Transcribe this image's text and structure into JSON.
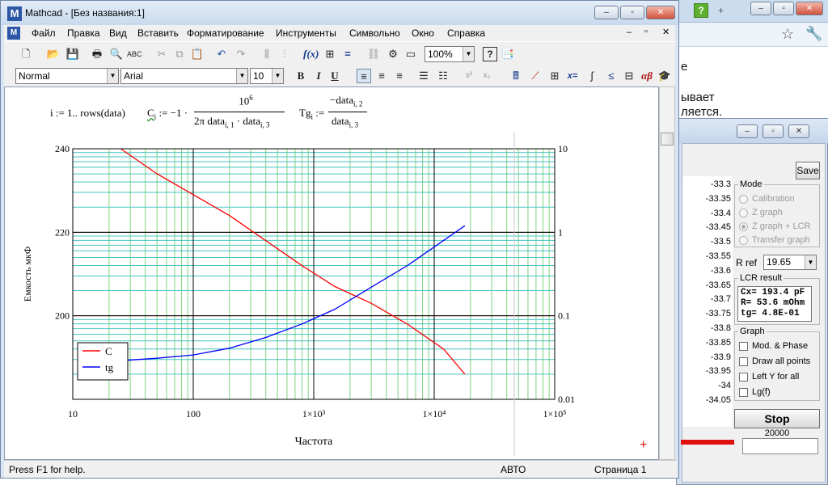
{
  "browser": {
    "fragment_line1": "е",
    "fragment_line2": "ывает",
    "fragment_line3": "ляется."
  },
  "lcr_app": {
    "save_label": "Save",
    "axis_ticks": [
      "-33.3",
      "-33.35",
      "-33.4",
      "-33.45",
      "-33.5",
      "-33.55",
      "-33.6",
      "-33.65",
      "-33.7",
      "-33.75",
      "-33.8",
      "-33.85",
      "-33.9",
      "-33.95",
      "-34",
      "-34.05"
    ],
    "mode_legend": "Mode",
    "mode_options": [
      {
        "label": "Calibration",
        "selected": false
      },
      {
        "label": "Z graph",
        "selected": false
      },
      {
        "label": "Z graph + LCR",
        "selected": true
      },
      {
        "label": "Transfer graph",
        "selected": false
      }
    ],
    "rref_label": "R ref",
    "rref_value": "19.65",
    "lcr_result_legend": "LCR result",
    "lcr_result_lines": [
      "Cx= 193.4 pF",
      "R= 53.6 mOhm",
      "tg= 4.8E-01"
    ],
    "graph_legend": "Graph",
    "graph_options": [
      {
        "label": "Mod. & Phase",
        "checked": false
      },
      {
        "label": "Draw all points",
        "checked": false
      },
      {
        "label": "Left Y for all",
        "checked": false
      },
      {
        "label": "Lg(f)",
        "checked": false
      }
    ],
    "stop_label": "Stop",
    "freq_value": "20000"
  },
  "mathcad": {
    "title": "Mathcad - [Без названия:1]",
    "menu": [
      "Файл",
      "Правка",
      "Вид",
      "Вставить",
      "Форматирование",
      "Инструменты",
      "Символьно",
      "Окно",
      "Справка"
    ],
    "zoom": "100%",
    "style_value": "Normal",
    "font_value": "Arial",
    "size_value": "10",
    "formulas": {
      "range_def": "i := 1.. rows(data)",
      "c_lhs": "C",
      "c_sub": "i",
      "c_rhs_prefix": ":= −1 ·",
      "c_num": "10",
      "c_num_exp": "6",
      "c_den": "2π data",
      "c_den_sub1": "i, 1",
      "c_den_mid": "· data",
      "c_den_sub2": "i, 3",
      "tg_lhs": "Tg",
      "tg_sub": "i",
      "tg_assign": ":=",
      "tg_num": "−data",
      "tg_num_sub": "i, 2",
      "tg_den": "data",
      "tg_den_sub": "i, 3"
    },
    "status": {
      "help": "Press F1 for help.",
      "mode": "АВТО",
      "page": "Страница 1"
    }
  },
  "chart_data": {
    "type": "line",
    "xlabel": "Частота",
    "ylabel": "Емкость мкФ",
    "x_scale": "log",
    "xlim": [
      10,
      100000
    ],
    "x_ticks": [
      "10",
      "100",
      "1×10³",
      "1×10⁴",
      "1×10⁵"
    ],
    "y_left_lim": [
      180,
      240
    ],
    "y_left_ticks": [
      "240",
      "220",
      "200"
    ],
    "y_right_scale": "log",
    "y_right_lim": [
      0.01,
      10
    ],
    "y_right_ticks": [
      "10",
      "1",
      "0.1",
      "0.01"
    ],
    "grid": true,
    "legend_position": "bottom-left",
    "series": [
      {
        "name": "C",
        "axis": "left",
        "color": "#ff0000",
        "x": [
          25,
          50,
          100,
          200,
          400,
          800,
          1500,
          3000,
          6000,
          12000,
          18000
        ],
        "y": [
          240,
          234,
          229,
          224,
          218,
          212,
          207,
          203,
          198,
          192,
          186
        ]
      },
      {
        "name": "tg",
        "axis": "right",
        "color": "#0000ff",
        "x": [
          25,
          50,
          100,
          200,
          400,
          800,
          1500,
          3000,
          6000,
          12000,
          18000
        ],
        "y": [
          0.029,
          0.031,
          0.034,
          0.041,
          0.055,
          0.08,
          0.12,
          0.22,
          0.4,
          0.8,
          1.2
        ]
      }
    ]
  }
}
